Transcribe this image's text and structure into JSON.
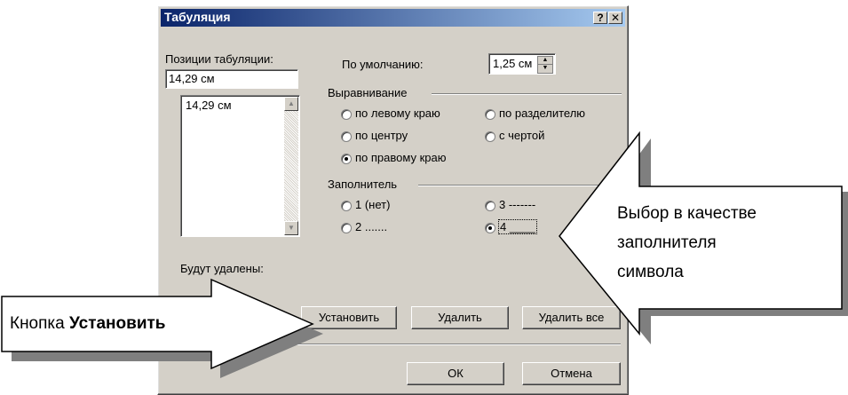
{
  "dialog": {
    "title": "Табуляция",
    "help_glyph": "?",
    "close_glyph": "✕",
    "tab_positions_label": "Позиции табуляции:",
    "tab_position_value": "14,29 см",
    "tab_list": [
      "14,29 см"
    ],
    "default_label": "По умолчанию:",
    "default_value": "1,25 см",
    "alignment_label": "Выравнивание",
    "alignment_options": [
      "по левому краю",
      "по разделителю",
      "по центру",
      "с чертой",
      "по правому краю"
    ],
    "alignment_selected": "по правому краю",
    "leader_label": "Заполнитель",
    "leader_options": [
      "1 (нет)",
      "3 -------",
      "2 .......",
      "4 ____"
    ],
    "leader_selected": "4 ____",
    "will_be_deleted_label": "Будут удалены:",
    "buttons": {
      "set": "Установить",
      "delete": "Удалить",
      "delete_all": "Удалить все",
      "ok": "ОК",
      "cancel": "Отмена"
    }
  },
  "callouts": {
    "right_line1": "Выбор в качестве",
    "right_line2": "заполнителя",
    "right_line3": "символа",
    "left_prefix": "Кнопка ",
    "left_bold": "Установить"
  },
  "colors": {
    "title_start": "#0a246a",
    "title_end": "#a6caf0",
    "face": "#d4d0c8"
  }
}
